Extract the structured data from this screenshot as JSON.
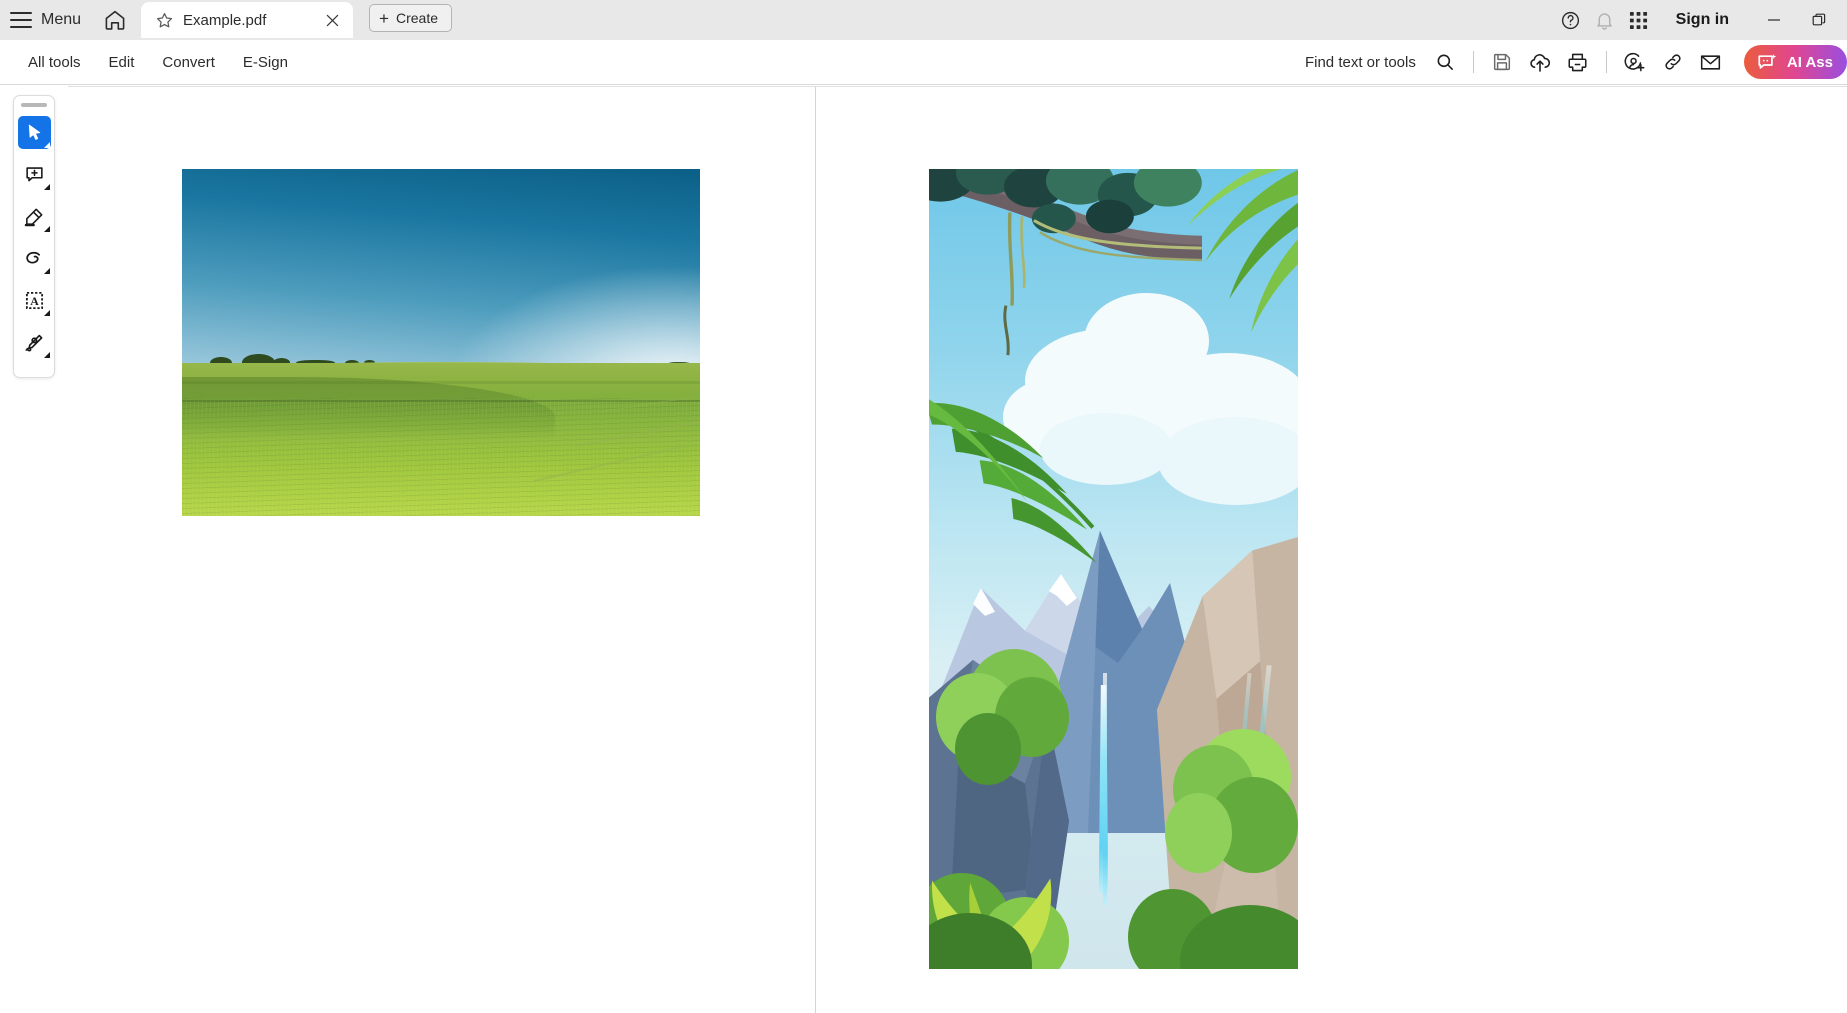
{
  "titlebar": {
    "menu_label": "Menu",
    "home_icon": "home-icon",
    "tab": {
      "star_icon": "star-icon",
      "title": "Example.pdf",
      "close_icon": "close-icon"
    },
    "create_button": {
      "plus": "+",
      "label": "Create"
    },
    "help_icon": "help-circle-icon",
    "notifications_icon": "bell-icon",
    "apps_icon": "app-grid-icon",
    "sign_in_label": "Sign in",
    "minimize_icon": "minimize-icon",
    "restore_icon": "restore-window-icon"
  },
  "toolbar": {
    "items": [
      {
        "label": "All tools",
        "name": "tab-all-tools"
      },
      {
        "label": "Edit",
        "name": "tab-edit"
      },
      {
        "label": "Convert",
        "name": "tab-convert"
      },
      {
        "label": "E-Sign",
        "name": "tab-esign"
      }
    ],
    "find_label": "Find text or tools",
    "search_icon": "search-icon",
    "save_icon": "save-icon",
    "cloud_upload_icon": "cloud-upload-icon",
    "print_icon": "print-icon",
    "stamp_icon": "add-stamp-icon",
    "link_icon": "link-icon",
    "email_icon": "email-icon",
    "ai_assistant_label": "AI Ass",
    "ai_assistant_icon": "ai-assistant-icon",
    "ai_gradient": "#eb5c3d,#e0468f,#9a4ee0"
  },
  "tool_rail": {
    "handle": "drag-handle",
    "tools": [
      {
        "name": "select-tool",
        "icon": "cursor-arrow-icon",
        "active": true
      },
      {
        "name": "comment-tool",
        "icon": "add-comment-icon",
        "active": false
      },
      {
        "name": "highlight-tool",
        "icon": "highlighter-icon",
        "active": false
      },
      {
        "name": "draw-tool",
        "icon": "freehand-loop-icon",
        "active": false
      },
      {
        "name": "add-text-tool",
        "icon": "text-box-icon",
        "active": false
      },
      {
        "name": "sign-tool",
        "icon": "signature-pen-icon",
        "active": false
      }
    ]
  },
  "document": {
    "pages": [
      {
        "name": "page-1",
        "content": "landscape-photo-green-field-blue-sky"
      },
      {
        "name": "page-2",
        "content": "illustration-jungle-mountains-waterfall"
      }
    ]
  },
  "colors": {
    "accent_blue": "#1473e6",
    "titlebar_bg": "#e8e8e8",
    "toolbar_bg": "#ffffff",
    "text": "#2c2c2c"
  }
}
